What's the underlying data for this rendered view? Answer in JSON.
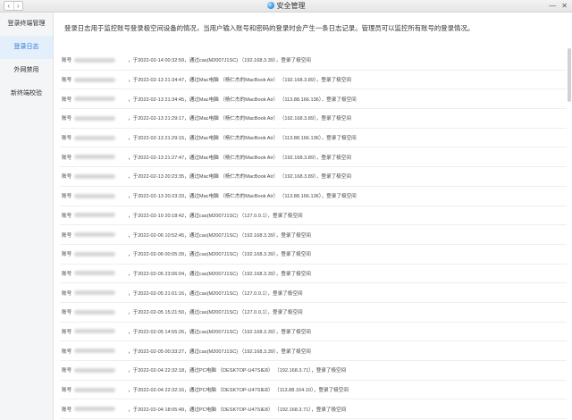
{
  "window": {
    "title": "安全管理",
    "back": "‹",
    "forward": "›",
    "minimize": "—",
    "close": "✕"
  },
  "sidebar": {
    "items": [
      {
        "label": "登录终端管理"
      },
      {
        "label": "登录日志",
        "active": true
      },
      {
        "label": "外网禁用"
      },
      {
        "label": "新终端校验"
      }
    ]
  },
  "main": {
    "description": "登录日志用于监控账号登录极空间设备的情况，当用户输入账号和密码的登录时会产生一条日志记录。管理员可以监控所有账号的登录情况。",
    "account_label": "账号",
    "logs": [
      {
        "text": "，于2022-02-14 00:32:59，通过cas(M2007J1SC) （192.168.3.39），登录了极空间"
      },
      {
        "text": "，于2022-02-13 21:34:47，通过Mac电脑 （杨仁杰的MacBook Air） （192.168.3.89），登录了极空间"
      },
      {
        "text": "，于2022-02-13 21:34:45，通过Mac电脑 （杨仁杰的MacBook Air） （113.88.166.136），登录了极空间"
      },
      {
        "text": "，于2022-02-13 21:29:17，通过Mac电脑 （杨仁杰的MacBook Air） （192.168.3.89），登录了极空间"
      },
      {
        "text": "，于2022-02-13 21:29:15，通过Mac电脑 （杨仁杰的MacBook Air） （113.88.166.136），登录了极空间"
      },
      {
        "text": "，于2022-02-13 21:27:47，通过Mac电脑 （杨仁杰的MacBook Air） （192.168.3.89），登录了极空间"
      },
      {
        "text": "，于2022-02-13 20:23:35，通过Mac电脑 （杨仁杰的MacBook Air） （192.168.3.89），登录了极空间"
      },
      {
        "text": "，于2022-02-13 20:23:33，通过Mac电脑 （杨仁杰的MacBook Air） （113.88.166.136），登录了极空间"
      },
      {
        "text": "，于2022-02-10 20:18:42，通过cas(M2007J1SC) （127.0.0.1），登录了极空间"
      },
      {
        "text": "，于2022-02-06 10:52:45，通过cas(M2007J1SC) （192.168.3.39），登录了极空间"
      },
      {
        "text": "，于2022-02-06 00:05:39，通过cas(M2007J1SC) （192.168.3.39），登录了极空间"
      },
      {
        "text": "，于2022-02-05 23:06:04，通过cas(M2007J1SC) （192.168.3.39），登录了极空间"
      },
      {
        "text": "，于2022-02-05 21:01:16，通过cas(M2007J1SC) （127.0.0.1），登录了极空间"
      },
      {
        "text": "，于2022-02-05 15:21:50，通过cas(M2007J1SC) （127.0.0.1），登录了极空间"
      },
      {
        "text": "，于2022-02-05 14:55:26，通过cas(M2007J1SC) （192.168.3.39），登录了极空间"
      },
      {
        "text": "，于2022-02-05 00:33:27，通过cas(M2007J1SC) （192.168.3.39），登录了极空间"
      },
      {
        "text": "，于2022-02-04 22:32:18，通过PC电脑 （DESKTOP-U47SIE8） （192.168.3.71），登录了极空间"
      },
      {
        "text": "，于2022-02-04 22:32:16，通过PC电脑 （DESKTOP-U47SIE8） （113.88.164.10），登录了极空间"
      },
      {
        "text": "，于2022-02-04 18:05:49，通过PC电脑 （DESKTOP-U47SIE8） （192.168.3.71），登录了极空间"
      }
    ]
  },
  "colors": {
    "accent": "#2a7ad4",
    "sidebar_bg": "#f4f5f7",
    "active_bg": "#e3effb"
  }
}
